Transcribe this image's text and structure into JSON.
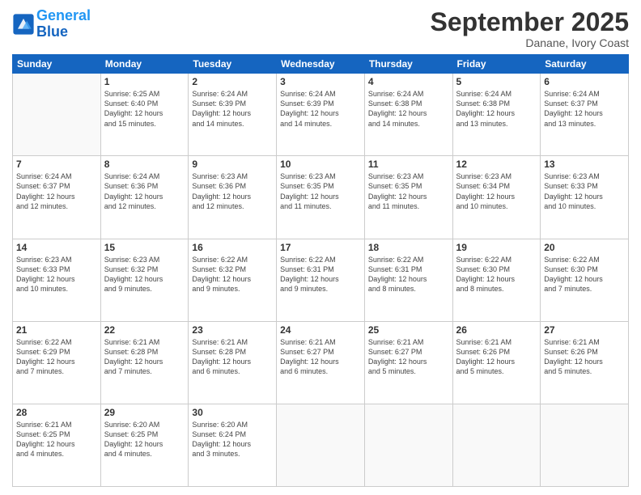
{
  "header": {
    "logo_line1": "General",
    "logo_line2": "Blue",
    "month": "September 2025",
    "location": "Danane, Ivory Coast"
  },
  "weekdays": [
    "Sunday",
    "Monday",
    "Tuesday",
    "Wednesday",
    "Thursday",
    "Friday",
    "Saturday"
  ],
  "weeks": [
    [
      {
        "day": "",
        "content": ""
      },
      {
        "day": "1",
        "content": "Sunrise: 6:25 AM\nSunset: 6:40 PM\nDaylight: 12 hours\nand 15 minutes."
      },
      {
        "day": "2",
        "content": "Sunrise: 6:24 AM\nSunset: 6:39 PM\nDaylight: 12 hours\nand 14 minutes."
      },
      {
        "day": "3",
        "content": "Sunrise: 6:24 AM\nSunset: 6:39 PM\nDaylight: 12 hours\nand 14 minutes."
      },
      {
        "day": "4",
        "content": "Sunrise: 6:24 AM\nSunset: 6:38 PM\nDaylight: 12 hours\nand 14 minutes."
      },
      {
        "day": "5",
        "content": "Sunrise: 6:24 AM\nSunset: 6:38 PM\nDaylight: 12 hours\nand 13 minutes."
      },
      {
        "day": "6",
        "content": "Sunrise: 6:24 AM\nSunset: 6:37 PM\nDaylight: 12 hours\nand 13 minutes."
      }
    ],
    [
      {
        "day": "7",
        "content": "Sunrise: 6:24 AM\nSunset: 6:37 PM\nDaylight: 12 hours\nand 12 minutes."
      },
      {
        "day": "8",
        "content": "Sunrise: 6:24 AM\nSunset: 6:36 PM\nDaylight: 12 hours\nand 12 minutes."
      },
      {
        "day": "9",
        "content": "Sunrise: 6:23 AM\nSunset: 6:36 PM\nDaylight: 12 hours\nand 12 minutes."
      },
      {
        "day": "10",
        "content": "Sunrise: 6:23 AM\nSunset: 6:35 PM\nDaylight: 12 hours\nand 11 minutes."
      },
      {
        "day": "11",
        "content": "Sunrise: 6:23 AM\nSunset: 6:35 PM\nDaylight: 12 hours\nand 11 minutes."
      },
      {
        "day": "12",
        "content": "Sunrise: 6:23 AM\nSunset: 6:34 PM\nDaylight: 12 hours\nand 10 minutes."
      },
      {
        "day": "13",
        "content": "Sunrise: 6:23 AM\nSunset: 6:33 PM\nDaylight: 12 hours\nand 10 minutes."
      }
    ],
    [
      {
        "day": "14",
        "content": "Sunrise: 6:23 AM\nSunset: 6:33 PM\nDaylight: 12 hours\nand 10 minutes."
      },
      {
        "day": "15",
        "content": "Sunrise: 6:23 AM\nSunset: 6:32 PM\nDaylight: 12 hours\nand 9 minutes."
      },
      {
        "day": "16",
        "content": "Sunrise: 6:22 AM\nSunset: 6:32 PM\nDaylight: 12 hours\nand 9 minutes."
      },
      {
        "day": "17",
        "content": "Sunrise: 6:22 AM\nSunset: 6:31 PM\nDaylight: 12 hours\nand 9 minutes."
      },
      {
        "day": "18",
        "content": "Sunrise: 6:22 AM\nSunset: 6:31 PM\nDaylight: 12 hours\nand 8 minutes."
      },
      {
        "day": "19",
        "content": "Sunrise: 6:22 AM\nSunset: 6:30 PM\nDaylight: 12 hours\nand 8 minutes."
      },
      {
        "day": "20",
        "content": "Sunrise: 6:22 AM\nSunset: 6:30 PM\nDaylight: 12 hours\nand 7 minutes."
      }
    ],
    [
      {
        "day": "21",
        "content": "Sunrise: 6:22 AM\nSunset: 6:29 PM\nDaylight: 12 hours\nand 7 minutes."
      },
      {
        "day": "22",
        "content": "Sunrise: 6:21 AM\nSunset: 6:28 PM\nDaylight: 12 hours\nand 7 minutes."
      },
      {
        "day": "23",
        "content": "Sunrise: 6:21 AM\nSunset: 6:28 PM\nDaylight: 12 hours\nand 6 minutes."
      },
      {
        "day": "24",
        "content": "Sunrise: 6:21 AM\nSunset: 6:27 PM\nDaylight: 12 hours\nand 6 minutes."
      },
      {
        "day": "25",
        "content": "Sunrise: 6:21 AM\nSunset: 6:27 PM\nDaylight: 12 hours\nand 5 minutes."
      },
      {
        "day": "26",
        "content": "Sunrise: 6:21 AM\nSunset: 6:26 PM\nDaylight: 12 hours\nand 5 minutes."
      },
      {
        "day": "27",
        "content": "Sunrise: 6:21 AM\nSunset: 6:26 PM\nDaylight: 12 hours\nand 5 minutes."
      }
    ],
    [
      {
        "day": "28",
        "content": "Sunrise: 6:21 AM\nSunset: 6:25 PM\nDaylight: 12 hours\nand 4 minutes."
      },
      {
        "day": "29",
        "content": "Sunrise: 6:20 AM\nSunset: 6:25 PM\nDaylight: 12 hours\nand 4 minutes."
      },
      {
        "day": "30",
        "content": "Sunrise: 6:20 AM\nSunset: 6:24 PM\nDaylight: 12 hours\nand 3 minutes."
      },
      {
        "day": "",
        "content": ""
      },
      {
        "day": "",
        "content": ""
      },
      {
        "day": "",
        "content": ""
      },
      {
        "day": "",
        "content": ""
      }
    ]
  ]
}
